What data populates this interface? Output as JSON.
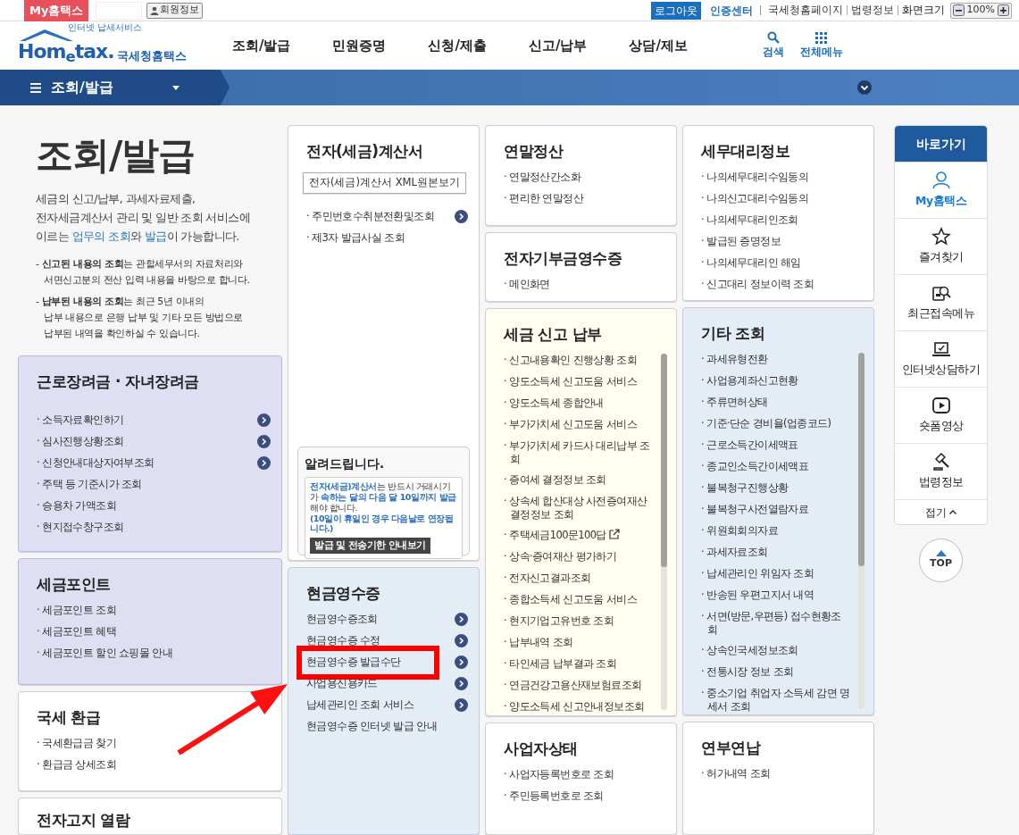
{
  "top_bar": {
    "my_hometax": "My홈택스",
    "member_info": "회원정보",
    "logout": "로그아웃",
    "cert_center": "인증센터",
    "links": [
      "국세청홈페이지",
      "법령정보"
    ],
    "zoom_label": "화면크기",
    "zoom_level": "100%"
  },
  "header": {
    "logo_tagline": "인터넷 납세서비스",
    "logo_word": "Hom$_{e}$tax.",
    "logo_name": "국세청홈택스",
    "nav": [
      "조회/발급",
      "민원증명",
      "신청/제출",
      "신고/납부",
      "상담/제보"
    ],
    "search": "검색",
    "all_menu": "전체메뉴"
  },
  "section_bar": {
    "label": "조회/발급"
  },
  "intro": {
    "title": "조회/발급",
    "description": [
      {
        "text": "세금의 신고/납부, 과세자료제출,\n전자세금계산서 관리 및 일반 조회 서비스에\n이르는 ",
        "highlight": false
      },
      {
        "text": "업무의 조회",
        "highlight": true
      },
      {
        "text": "와 ",
        "highlight": false
      },
      {
        "text": "발급",
        "highlight": true
      },
      {
        "text": "이 가능합니다.",
        "highlight": false
      }
    ],
    "notes": [
      "- **신고된 내용의 조회**는 관할세무서의 자료처리와\n서면신고분의 전산 입력 내용을 바탕으로 합니다.",
      "- **납부된 내용의 조회**는 최근 5년 이내의\n납부 내용으로 은행 납부 및 기타 모든 방법으로\n납부된 내역을 확인하실 수 있습니다."
    ]
  },
  "columns": [
    {
      "cards": [
        {
          "title": "근로장려금 · 자녀장려금",
          "items": [
            {
              "label": "· 소득자료확인하기",
              "arrow": true
            },
            {
              "label": "· 심사진행상황조회",
              "arrow": true
            },
            {
              "label": "· 신청안내대상자여부조회",
              "arrow": true
            },
            {
              "label": "· 주택 등 기준시가 조회",
              "arrow": false
            },
            {
              "label": "· 승용차 가액조회",
              "arrow": false
            },
            {
              "label": "· 현지접수창구조회",
              "arrow": false
            }
          ]
        },
        {
          "title": "세금포인트",
          "items": [
            {
              "label": "· 세금포인트 조회"
            },
            {
              "label": "· 세금포인트 혜택"
            },
            {
              "label": "· 세금포인트 할인 쇼핑몰 안내"
            }
          ]
        },
        {
          "title": "국세 환급",
          "items": [
            {
              "label": "· 국세환급금 찾기"
            },
            {
              "label": "· 환급금 상세조회"
            }
          ]
        },
        {
          "title": "전자고지 열람"
        }
      ]
    },
    {
      "cards": [
        {
          "title": "전자(세금)계산서",
          "xml_button": "전자(세금)계산서 XML원본보기",
          "items": [
            {
              "label": "· 주민번호수취분전환및조회",
              "arrow": true
            },
            {
              "label": "· 제3자 발급사실 조회",
              "arrow": false
            }
          ],
          "notice": {
            "title": "알려드립니다.",
            "text": [
              {
                "text": "전자(세금)계산서",
                "highlight": true
              },
              {
                "text": "는 반드시 거래시기가 ",
                "highlight": false
              },
              {
                "text": "속하는 달의 다음 달 10일까지 발급",
                "highlight": true
              },
              {
                "text": " 해야 합니다.",
                "highlight": false
              }
            ],
            "footnote": "(10일이 휴일인 경우 다음날로 연장됩니다.)",
            "button": "발급 및 전송기한 안내보기"
          }
        },
        {
          "title": "현금영수증",
          "items": [
            {
              "label": "현금영수증조회",
              "arrow": true,
              "highlighted": false
            },
            {
              "label": "현금영수증 수정",
              "arrow": true,
              "highlighted": false
            },
            {
              "label": "현금영수증 발급수단",
              "arrow": true,
              "highlighted": true
            },
            {
              "label": "사업용신용카드",
              "arrow": true,
              "highlighted": false
            },
            {
              "label": "납세관리인 조회 서비스",
              "arrow": true,
              "highlighted": false
            },
            {
              "label": "현금영수증 인터넷 발급 안내",
              "arrow": false,
              "highlighted": false
            }
          ]
        }
      ]
    },
    {
      "cards": [
        {
          "title": "연말정산",
          "items": [
            {
              "label": "· 연말정산간소화"
            },
            {
              "label": "· 편리한 연말정산"
            }
          ]
        },
        {
          "title": "전자기부금영수증",
          "items": [
            {
              "label": "· 메인화면"
            }
          ]
        },
        {
          "title": "세금 신고 납부",
          "scrollable": true,
          "items": [
            {
              "label": "· 신고내용확인 진행상황 조회"
            },
            {
              "label": "· 양도소득세 신고도움 서비스"
            },
            {
              "label": "· 양도소득세 종합안내"
            },
            {
              "label": "· 부가가치세 신고도움 서비스"
            },
            {
              "label": "· 부가가치세 카드사 대리납부 조회"
            },
            {
              "label": "· 증여세 결정정보 조회"
            },
            {
              "label": "· 상속세 합산대상 사전증여재산 결정정보 조회"
            },
            {
              "label": "· 주택세금100문100답",
              "external": true
            },
            {
              "label": "· 상속·증여재산 평가하기"
            },
            {
              "label": "· 전자신고결과조회"
            },
            {
              "label": "· 종합소득세 신고도움 서비스"
            },
            {
              "label": "· 현지기업고유번호 조회"
            },
            {
              "label": "· 납부내역 조회"
            },
            {
              "label": "· 타인세금 납부결과 조회"
            },
            {
              "label": "· 연금건강고용산재보험료조회"
            },
            {
              "label": "· 양도소득세 신고안내정보조회"
            }
          ]
        },
        {
          "title": "사업자상태",
          "items": [
            {
              "label": "· 사업자등록번호로 조회"
            },
            {
              "label": "· 주민등록번호로 조회"
            }
          ]
        }
      ]
    },
    {
      "cards": [
        {
          "title": "세무대리정보",
          "items": [
            {
              "label": "· 나의세무대리수임동의"
            },
            {
              "label": "· 나의신고대리수임동의"
            },
            {
              "label": "· 나의세무대리인조회"
            },
            {
              "label": "· 발급된 증명정보"
            },
            {
              "label": "· 나의세무대리인 해임"
            },
            {
              "label": "· 신고대리 정보이력 조회"
            }
          ]
        },
        {
          "title": "기타 조회",
          "scrollable": true,
          "items": [
            {
              "label": "· 과세유형전환"
            },
            {
              "label": "· 사업용계좌신고현황"
            },
            {
              "label": "· 주류면허상태"
            },
            {
              "label": "· 기준·단순 경비율(업종코드)"
            },
            {
              "label": "· 근로소득간이세액표"
            },
            {
              "label": "· 종교인소득간이세액표"
            },
            {
              "label": "· 불복청구진행상황"
            },
            {
              "label": "· 불복청구사전열람자료"
            },
            {
              "label": "· 위원회회의자료"
            },
            {
              "label": "· 과세자료조회"
            },
            {
              "label": "· 납세관리인 위임자 조회"
            },
            {
              "label": "· 반송된 우편고지서 내역"
            },
            {
              "label": "· 서면(방문,우편등) 접수현황조회"
            },
            {
              "label": "· 상속인국세정보조회"
            },
            {
              "label": "· 전통시장 정보 조회"
            },
            {
              "label": "· 중소기업 취업자 소득세 감면 명세서 조회"
            }
          ]
        },
        {
          "title": "연부연납",
          "items": [
            {
              "label": "· 허가내역 조회"
            }
          ]
        }
      ]
    }
  ],
  "quick_links": {
    "title": "바로가기",
    "items": [
      {
        "label": "My홈택스",
        "selected": true
      },
      {
        "label": "즐겨찾기",
        "selected": false
      },
      {
        "label": "최근접속메뉴",
        "selected": false
      },
      {
        "label": "인터넷상담하기",
        "selected": false
      },
      {
        "label": "숏폼영상",
        "selected": false
      },
      {
        "label": "법령정보",
        "selected": false
      }
    ],
    "collapse": "접기",
    "top_button": "TOP"
  }
}
